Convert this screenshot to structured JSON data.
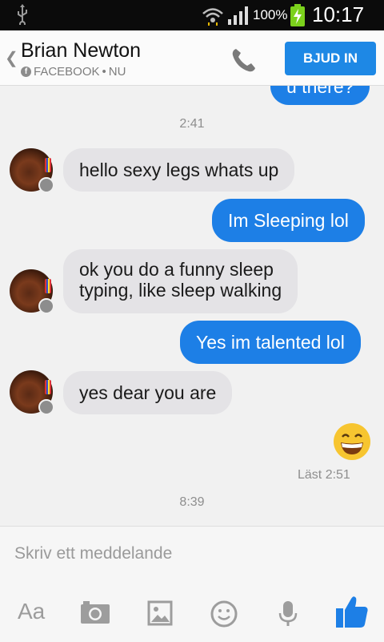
{
  "status_bar": {
    "battery_percent": "100%",
    "time": "10:17",
    "icons": [
      "usb-icon",
      "wifi-icon",
      "signal-icon",
      "battery-charging-icon"
    ]
  },
  "header": {
    "contact_name": "Brian Newton",
    "subtitle_source": "FACEBOOK",
    "subtitle_separator": "•",
    "subtitle_status": "NU",
    "invite_label": "BJUD IN"
  },
  "chat": {
    "clipped_outgoing_text": "u there?",
    "separator_1": "2:41",
    "messages": [
      {
        "direction": "in",
        "text": "hello sexy legs whats up"
      },
      {
        "direction": "out",
        "text": "Im Sleeping lol"
      },
      {
        "direction": "in",
        "lines": [
          "ok you do a funny sleep",
          "typing, like sleep walking"
        ]
      },
      {
        "direction": "out",
        "text": "Yes im talented lol"
      },
      {
        "direction": "in",
        "text": "yes dear you are"
      }
    ],
    "emoji": "grinning-face",
    "read_receipt": "Läst 2:51",
    "separator_2": "8:39"
  },
  "composer": {
    "placeholder": "Skriv ett meddelande",
    "aa_label": "Aa",
    "tools": [
      "camera-icon",
      "gallery-icon",
      "emoji-icon",
      "microphone-icon",
      "like-icon"
    ]
  },
  "colors": {
    "accent": "#1d7fe6",
    "incoming_bubble": "#e4e3e6",
    "status_bar": "#0b0b0b"
  }
}
